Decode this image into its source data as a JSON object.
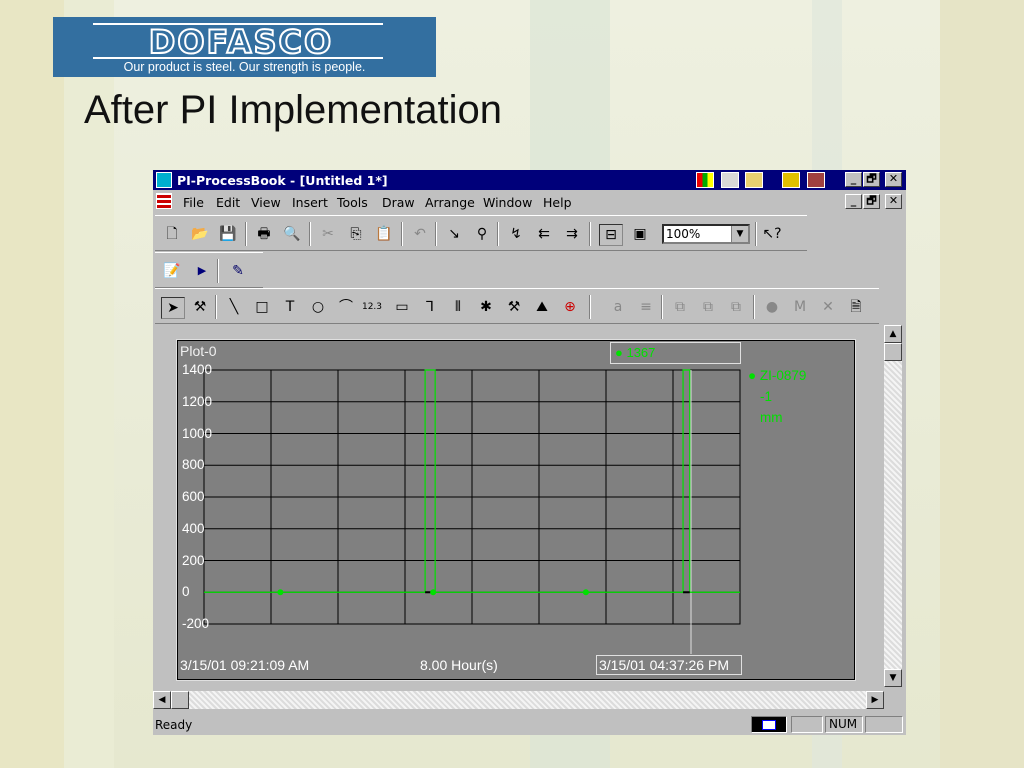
{
  "logo": {
    "word": "DOFASCO",
    "tagline": "Our product is steel. Our strength is people."
  },
  "slide": {
    "title": "After PI Implementation"
  },
  "app": {
    "title": "PI-ProcessBook - [Untitled 1*]",
    "caption_buttons": {
      "min": "_",
      "restore": "🗗",
      "close": "✕"
    },
    "menu": [
      "File",
      "Edit",
      "View",
      "Insert",
      "Tools",
      "Draw",
      "Arrange",
      "Window",
      "Help"
    ],
    "zoom_value": "100%",
    "status": {
      "ready": "Ready",
      "num": "NUM"
    }
  },
  "icons": {
    "toolbar1": [
      "new-file-icon",
      "open-folder-icon",
      "save-icon",
      "print-icon",
      "print-preview-icon",
      "cut-icon",
      "copy-icon",
      "paste-icon",
      "undo-icon",
      "run-mode-icon",
      "binoculars-icon",
      "trend-icon",
      "build-icon",
      "build2-icon",
      "toolbar-icon",
      "display-icon",
      "context-help-icon"
    ],
    "toolbar2": [
      "open-script-icon",
      "play-icon",
      "edit-icon"
    ],
    "toolbar3": [
      "select-arrow-icon",
      "hammer-icon",
      "line-icon",
      "rectangle-icon",
      "text-icon",
      "ellipse-icon",
      "arc-icon",
      "value-icon",
      "button-icon",
      "symbol-icon",
      "bar-icon",
      "graph-icon",
      "tools-icon",
      "trend-icon",
      "target-icon",
      "font-icon",
      "lines-icon",
      "group-icon",
      "ungroup-icon",
      "regroup-icon",
      "circle-icon",
      "m-icon",
      "x-icon",
      "properties-icon"
    ]
  },
  "colors": {
    "titlebar": "#00007a",
    "trend": "#00e000",
    "plot_bg": "#808080"
  },
  "chart_data": {
    "type": "line",
    "title": "Plot-0",
    "ylim": [
      -200,
      1400
    ],
    "y_ticks": [
      "1400",
      "1200",
      "1000",
      "800",
      "600",
      "400",
      "200",
      "0",
      "-200"
    ],
    "x_start": "3/15/01 09:21:09 AM",
    "x_span": "8.00 Hour(s)",
    "x_end": "3/15/01 04:37:26 PM",
    "cursor_value": "1367",
    "series": [
      {
        "name": "ZI-0879",
        "value": "-1",
        "unit": "mm",
        "x_hours": [
          0,
          3.3,
          3.3,
          3.45,
          3.45,
          7.15,
          7.15,
          7.25,
          7.25,
          8.0
        ],
        "values": [
          0,
          0,
          1400,
          1400,
          0,
          0,
          1400,
          1400,
          0,
          0
        ]
      }
    ]
  }
}
